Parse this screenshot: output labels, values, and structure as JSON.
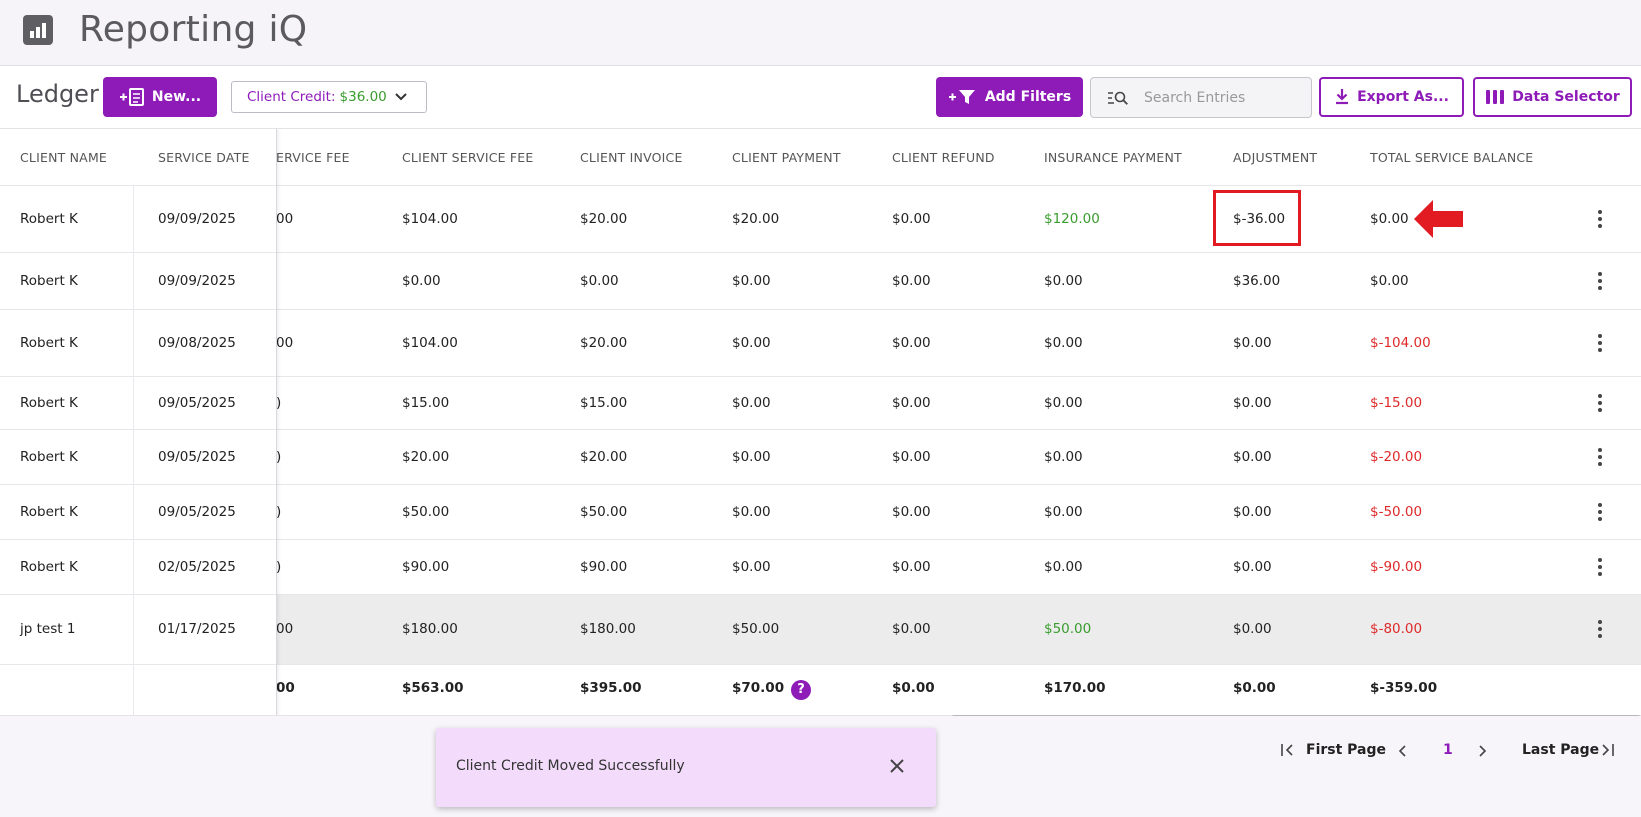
{
  "app": {
    "title": "Reporting iQ",
    "logo_icon": "bar-chart-icon"
  },
  "toolbar": {
    "page_title": "Ledger",
    "new_label": "New...",
    "client_credit_label": "Client Credit:",
    "client_credit_amount": "$36.00",
    "add_filters_label": "Add Filters",
    "search_placeholder": "Search Entries",
    "export_label": "Export As...",
    "data_selector_label": "Data Selector"
  },
  "columns": [
    "CLIENT NAME",
    "SERVICE DATE",
    "ERVICE FEE",
    "CLIENT SERVICE FEE",
    "CLIENT INVOICE",
    "CLIENT PAYMENT",
    "CLIENT REFUND",
    "INSURANCE PAYMENT",
    "ADJUSTMENT",
    "TOTAL SERVICE BALANCE"
  ],
  "rows": [
    {
      "client": "Robert K",
      "date": "09/09/2025",
      "fee": "00",
      "csf": "$104.00",
      "invoice": "$20.00",
      "payment": "$20.00",
      "refund": "$0.00",
      "ins": "$120.00",
      "adj": "$-36.00",
      "balance": "$0.00",
      "ins_color": "green",
      "bal_color": ""
    },
    {
      "client": "Robert K",
      "date": "09/09/2025",
      "fee": "",
      "csf": "$0.00",
      "invoice": "$0.00",
      "payment": "$0.00",
      "refund": "$0.00",
      "ins": "$0.00",
      "adj": "$36.00",
      "balance": "$0.00",
      "ins_color": "",
      "bal_color": ""
    },
    {
      "client": "Robert K",
      "date": "09/08/2025",
      "fee": "00",
      "csf": "$104.00",
      "invoice": "$20.00",
      "payment": "$0.00",
      "refund": "$0.00",
      "ins": "$0.00",
      "adj": "$0.00",
      "balance": "$-104.00",
      "ins_color": "",
      "bal_color": "red"
    },
    {
      "client": "Robert K",
      "date": "09/05/2025",
      "fee": ")",
      "csf": "$15.00",
      "invoice": "$15.00",
      "payment": "$0.00",
      "refund": "$0.00",
      "ins": "$0.00",
      "adj": "$0.00",
      "balance": "$-15.00",
      "ins_color": "",
      "bal_color": "red"
    },
    {
      "client": "Robert K",
      "date": "09/05/2025",
      "fee": ")",
      "csf": "$20.00",
      "invoice": "$20.00",
      "payment": "$0.00",
      "refund": "$0.00",
      "ins": "$0.00",
      "adj": "$0.00",
      "balance": "$-20.00",
      "ins_color": "",
      "bal_color": "red"
    },
    {
      "client": "Robert K",
      "date": "09/05/2025",
      "fee": ")",
      "csf": "$50.00",
      "invoice": "$50.00",
      "payment": "$0.00",
      "refund": "$0.00",
      "ins": "$0.00",
      "adj": "$0.00",
      "balance": "$-50.00",
      "ins_color": "",
      "bal_color": "red"
    },
    {
      "client": "Robert K",
      "date": "02/05/2025",
      "fee": ")",
      "csf": "$90.00",
      "invoice": "$90.00",
      "payment": "$0.00",
      "refund": "$0.00",
      "ins": "$0.00",
      "adj": "$0.00",
      "balance": "$-90.00",
      "ins_color": "",
      "bal_color": "red"
    },
    {
      "client": "jp test 1",
      "date": "01/17/2025",
      "fee": "00",
      "csf": "$180.00",
      "invoice": "$180.00",
      "payment": "$50.00",
      "refund": "$0.00",
      "ins": "$50.00",
      "adj": "$0.00",
      "balance": "$-80.00",
      "ins_color": "green",
      "bal_color": "red"
    }
  ],
  "totals": {
    "fee": "00",
    "csf": "$563.00",
    "invoice": "$395.00",
    "payment": "$70.00",
    "refund": "$0.00",
    "ins": "$170.00",
    "adj": "$0.00",
    "balance": "$-359.00",
    "help_glyph": "?"
  },
  "pagination": {
    "first_label": "First Page",
    "current_page": "1",
    "last_label": "Last Page"
  },
  "toast": {
    "message": "Client Credit Moved Successfully"
  },
  "colors": {
    "accent": "#8e1bb8",
    "positive": "#3a9c2e",
    "negative": "#de2a2a",
    "highlight": "#e21b23"
  }
}
